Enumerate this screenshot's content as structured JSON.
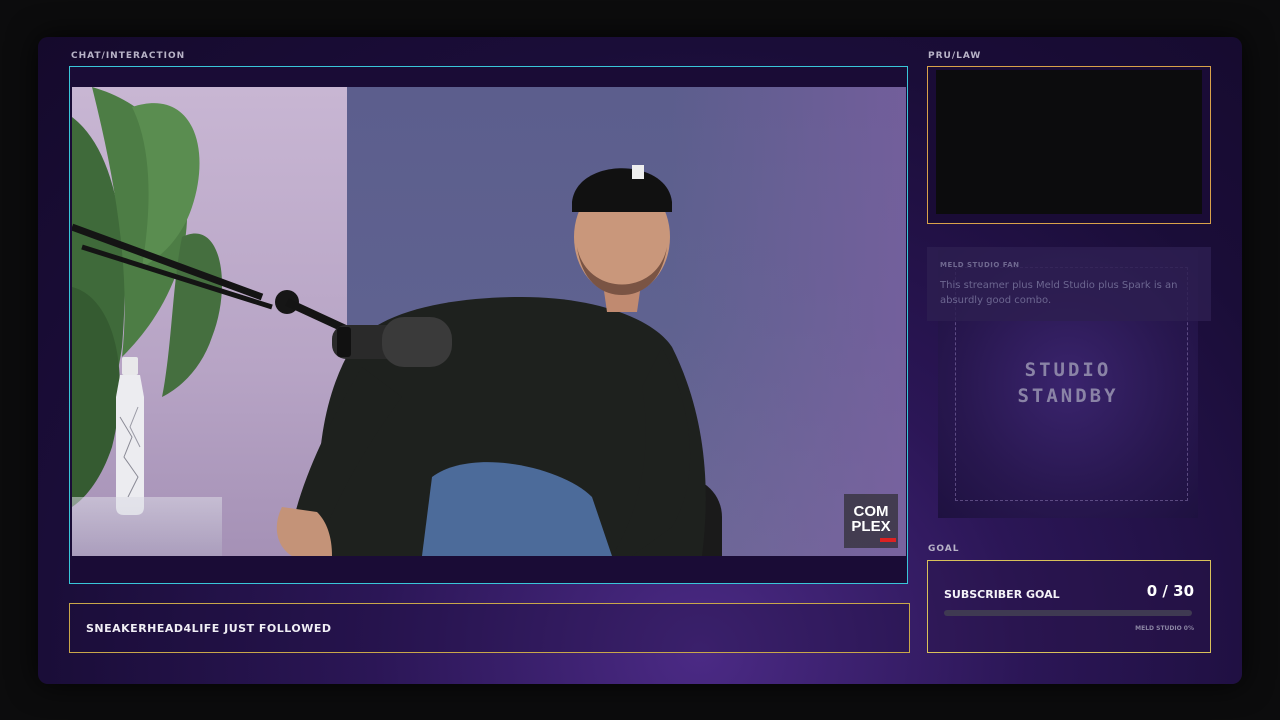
{
  "labels": {
    "chat": "CHAT/INTERACTION",
    "cam": "PRU/LAW",
    "goal": "GOAL"
  },
  "video": {
    "logo_line1": "COM",
    "logo_line2": "PLEX"
  },
  "alert": {
    "text": "SNEAKERHEAD4LIFE JUST FOLLOWED"
  },
  "standby": {
    "line1": "STUDIO",
    "line2": "STANDBY"
  },
  "chat_message": {
    "user": "MELD STUDIO FAN",
    "text": "This streamer plus Meld Studio plus Spark is an absurdly good combo."
  },
  "goal": {
    "title": "SUBSCRIBER GOAL",
    "count": "0 / 30",
    "progress": 0,
    "subtitle": "MELD STUDIO 0%"
  },
  "colors": {
    "video_border": "#39c6d9",
    "alert_border": "#c9a74a",
    "cam_border": "#d9a24a",
    "goal_border": "#d9c15a",
    "background": "#2b1656"
  }
}
